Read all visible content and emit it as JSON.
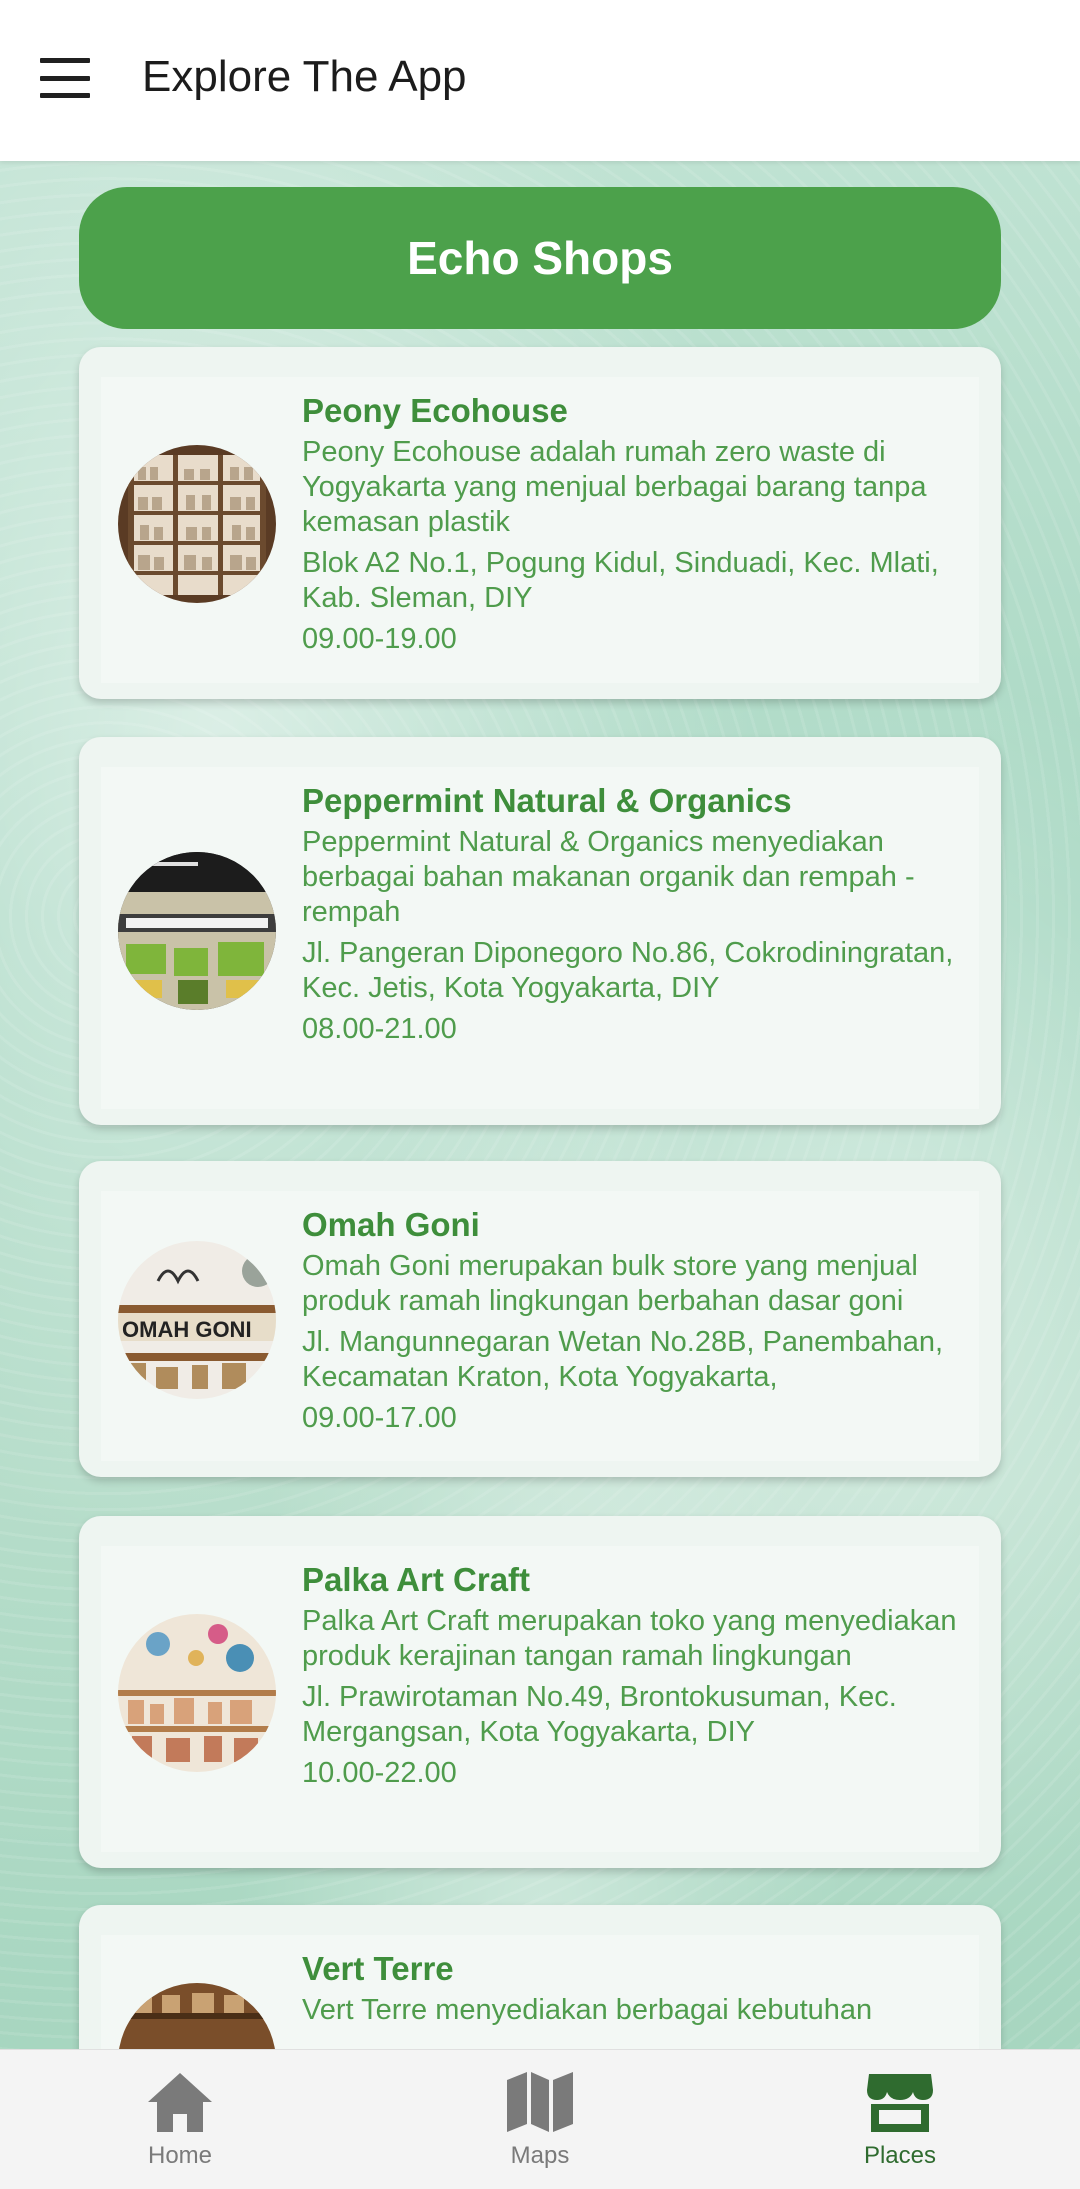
{
  "appbar": {
    "title": "Explore The App",
    "menu_icon": "hamburger-menu-icon"
  },
  "header": {
    "title": "Echo Shops",
    "color": "#4ca14b"
  },
  "shops": [
    {
      "name": "Peony Ecohouse",
      "description": "Peony Ecohouse adalah rumah zero waste di Yogyakarta yang menjual berbagai barang tanpa kemasan plastik",
      "address": "Blok A2 No.1, Pogung Kidul, Sinduadi, Kec. Mlati, Kab. Sleman, DIY",
      "hours": "09.00-19.00"
    },
    {
      "name": "Peppermint Natural & Organics",
      "description": "Peppermint Natural & Organics menyediakan berbagai bahan makanan organik dan rempah - rempah",
      "address": "Jl. Pangeran Diponegoro No.86, Cokrodiningratan, Kec. Jetis, Kota Yogyakarta, DIY",
      "hours": "08.00-21.00"
    },
    {
      "name": "Omah Goni",
      "description": "Omah Goni merupakan bulk store yang menjual produk ramah lingkungan berbahan dasar goni",
      "address": "Jl. Mangunnegaran Wetan No.28B, Panembahan, Kecamatan Kraton, Kota Yogyakarta,",
      "hours": "09.00-17.00",
      "photo_text": "OMAH GONI"
    },
    {
      "name": "Palka Art Craft",
      "description": "Palka Art Craft merupakan toko yang menyediakan produk kerajinan tangan ramah lingkungan",
      "address": "Jl. Prawirotaman No.49, Brontokusuman, Kec. Mergangsan, Kota Yogyakarta, DIY",
      "hours": "10.00-22.00"
    },
    {
      "name": "Vert Terre",
      "description": "Vert Terre menyediakan berbagai kebutuhan"
    }
  ],
  "nav": {
    "items": [
      {
        "label": "Home",
        "icon": "home-icon"
      },
      {
        "label": "Maps",
        "icon": "map-icon"
      },
      {
        "label": "Places",
        "icon": "store-icon",
        "active": true
      }
    ],
    "active_color": "#2f6b2f",
    "inactive_color": "#7a7a7a"
  }
}
